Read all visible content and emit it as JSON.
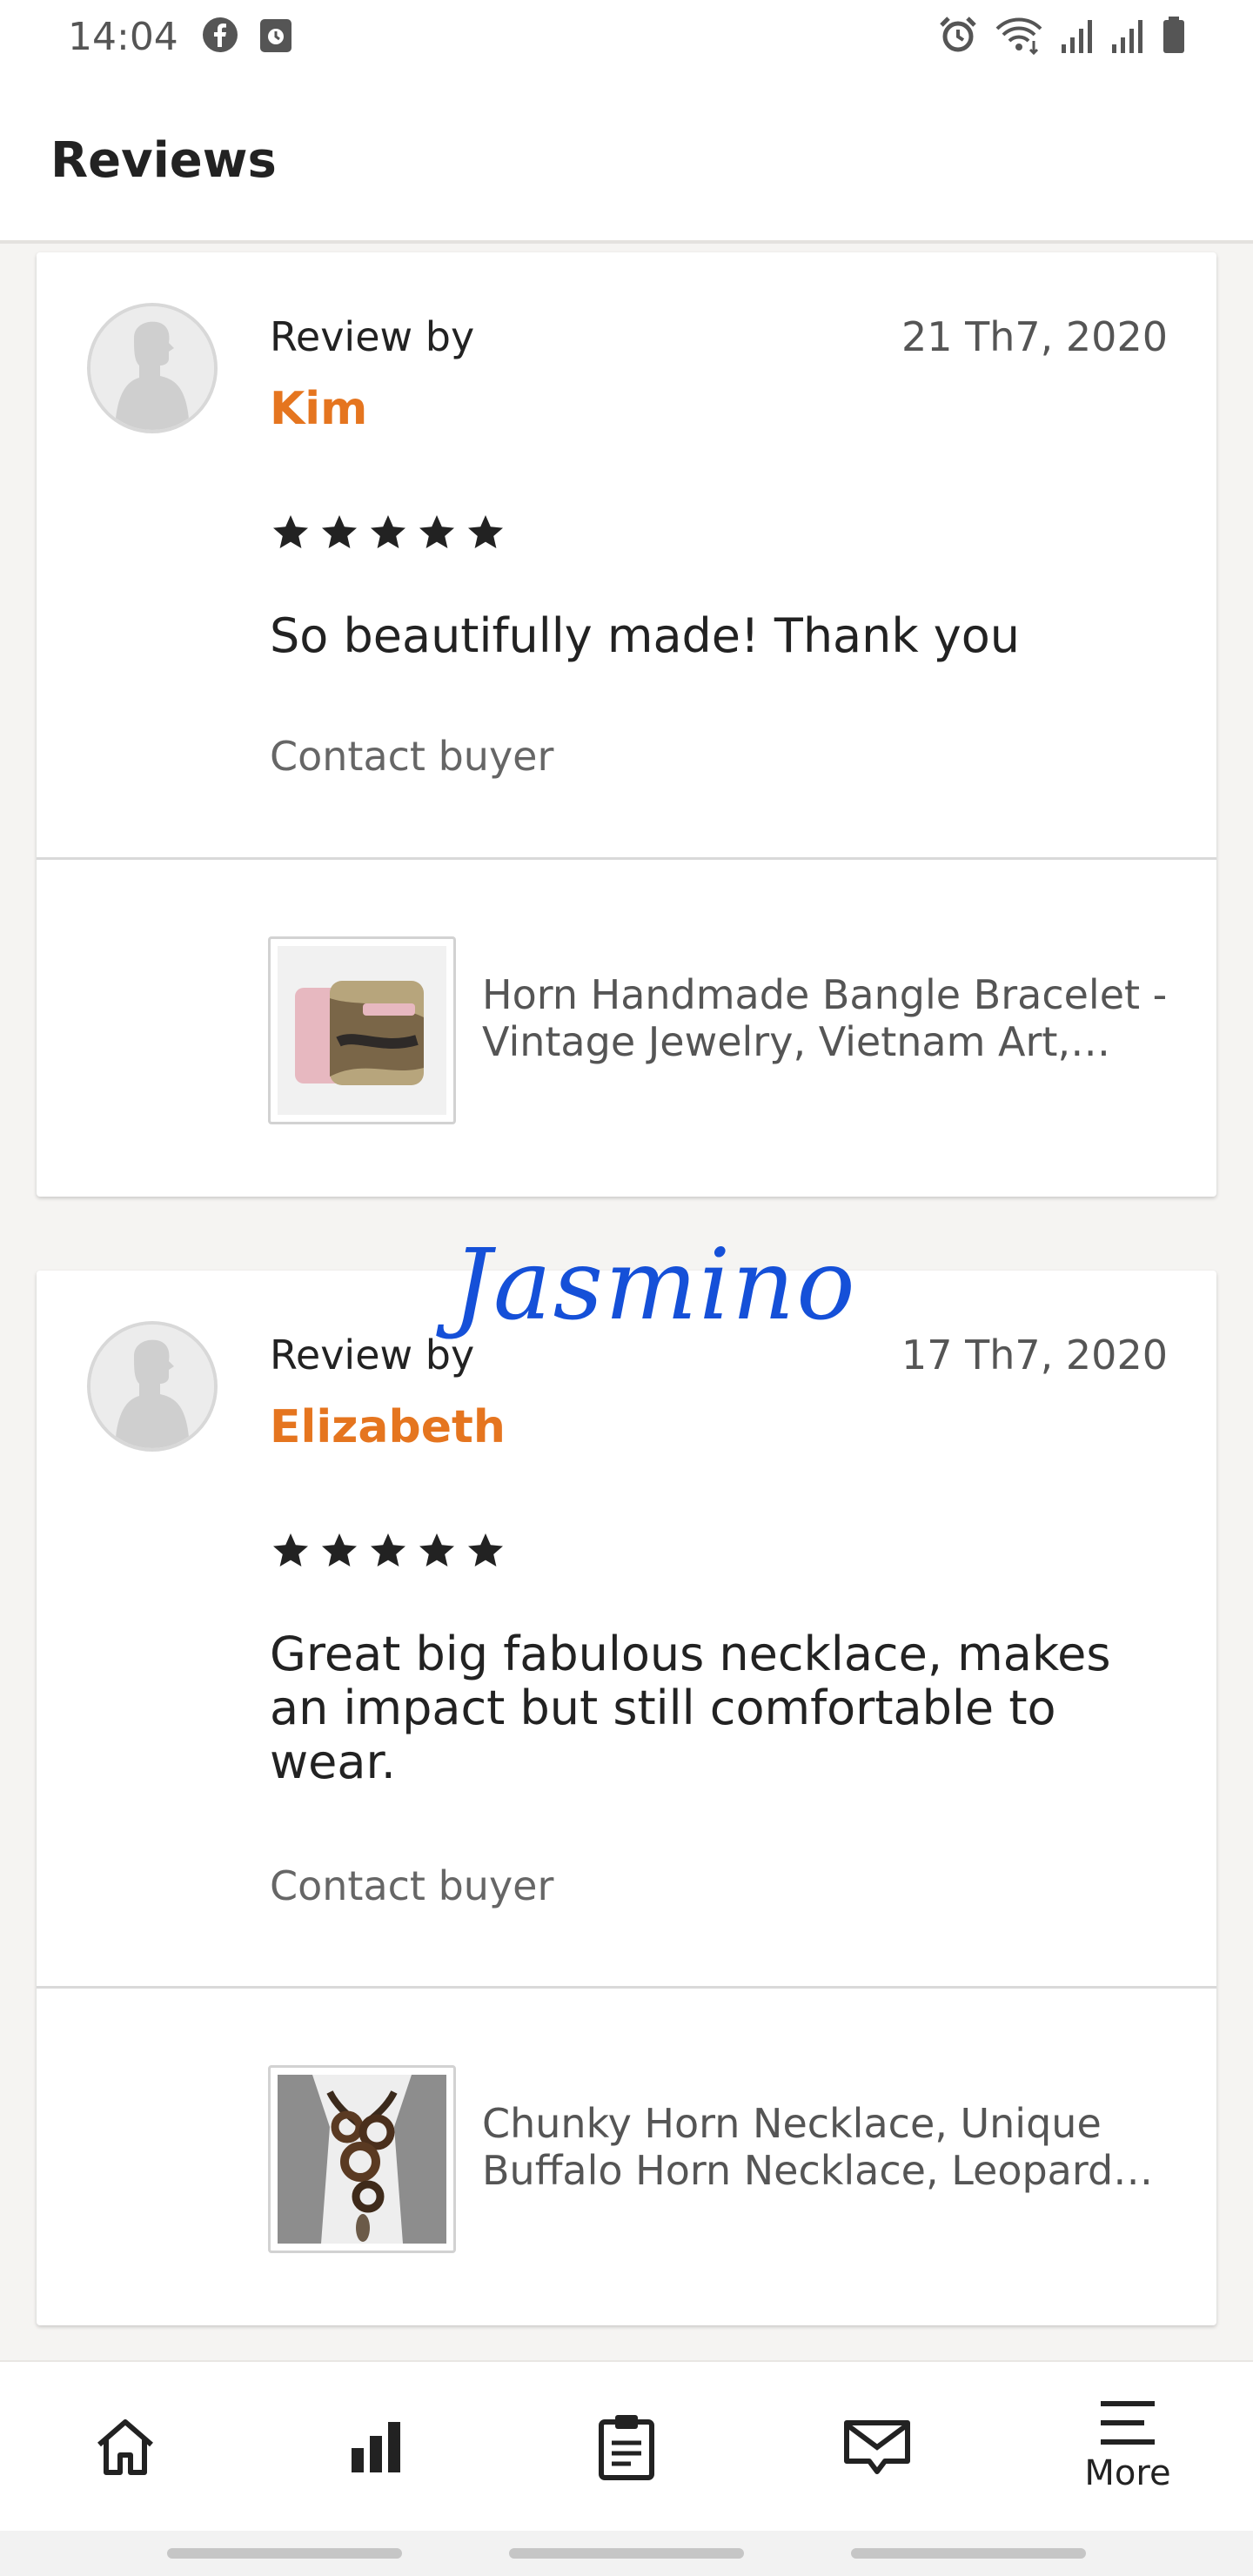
{
  "status_bar": {
    "time": "14:04",
    "left_icons": [
      "facebook-icon",
      "calendar-icon"
    ],
    "right_icons": [
      "alarm-icon",
      "wifi-icon",
      "signal-icon",
      "signal-icon",
      "battery-icon"
    ]
  },
  "header": {
    "title": "Reviews"
  },
  "reviews": [
    {
      "review_by_label": "Review by",
      "reviewer": "Kim",
      "date": "21 Th7, 2020",
      "rating": 5,
      "text": "So beautifully made! Thank you",
      "contact_label": "Contact buyer",
      "product_title": "Horn Handmade Bangle Bracelet - Vintage Jewelry, Vietnam Art, Handmade Horn Bangle"
    },
    {
      "review_by_label": "Review by",
      "reviewer": "Elizabeth",
      "date": "17 Th7, 2020",
      "rating": 5,
      "text": "Great big fabulous necklace, makes an impact but still comfortable to wear.",
      "contact_label": "Contact buyer",
      "product_title": "Chunky Horn Necklace, Unique Buffalo Horn Necklace, Leopard Print Necklace"
    }
  ],
  "watermark": "Jasmino",
  "nav": {
    "items": [
      {
        "icon": "home-icon"
      },
      {
        "icon": "stats-icon"
      },
      {
        "icon": "orders-icon"
      },
      {
        "icon": "messages-icon"
      },
      {
        "icon": "menu-icon",
        "label": "More"
      }
    ]
  },
  "colors": {
    "accent": "#e5751f",
    "background": "#f5f4f2",
    "watermark": "#1550d8"
  }
}
